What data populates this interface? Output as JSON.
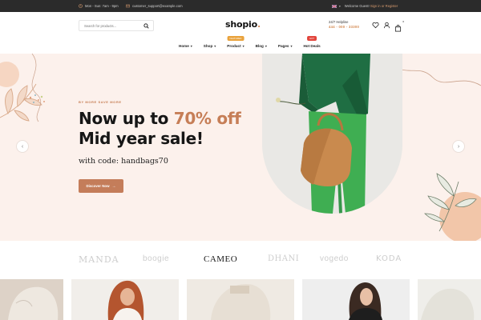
{
  "topbar": {
    "hours": "Mon - Sun: 7am - 9pm",
    "email": "customer_support@example.com",
    "welcome": "Welcome Guest!",
    "signin": "Sign in or Register"
  },
  "header": {
    "search_placeholder": "Search for products...",
    "logo_text": "shopio",
    "logo_dot": ".",
    "helpline_label": "24/7 Helpline",
    "helpline_number": "444 - 000 - 33300",
    "cart_count": "0"
  },
  "nav": {
    "items": [
      {
        "label": "Home",
        "caret": "▾"
      },
      {
        "label": "Shop",
        "caret": "▾"
      },
      {
        "label": "Product",
        "caret": "▾",
        "flag": "FEATURED",
        "flag_color": "#e9a23b"
      },
      {
        "label": "Blog",
        "caret": "▾"
      },
      {
        "label": "Pages",
        "caret": "▾"
      },
      {
        "label": "Hot Deals",
        "flag": "HOT",
        "flag_color": "#e2453c"
      }
    ]
  },
  "hero": {
    "eyebrow": "BY MORE SAVE MORE",
    "line1_pre": "Now up to ",
    "line1_highlight": "70% off",
    "line2": "Mid year sale!",
    "code_text": "with code: handbags70",
    "cta_label": "Discover Now",
    "cta_arrow": "→",
    "prev_arrow": "‹",
    "next_arrow": "›"
  },
  "brands": [
    "MANDA",
    "boogie",
    "CAMEO",
    "DHANI",
    "vogedo",
    "KODA"
  ],
  "colors": {
    "accent": "#c67e57",
    "hero_bg": "#fcf1ec",
    "topbar_bg": "#2b2b2b"
  }
}
